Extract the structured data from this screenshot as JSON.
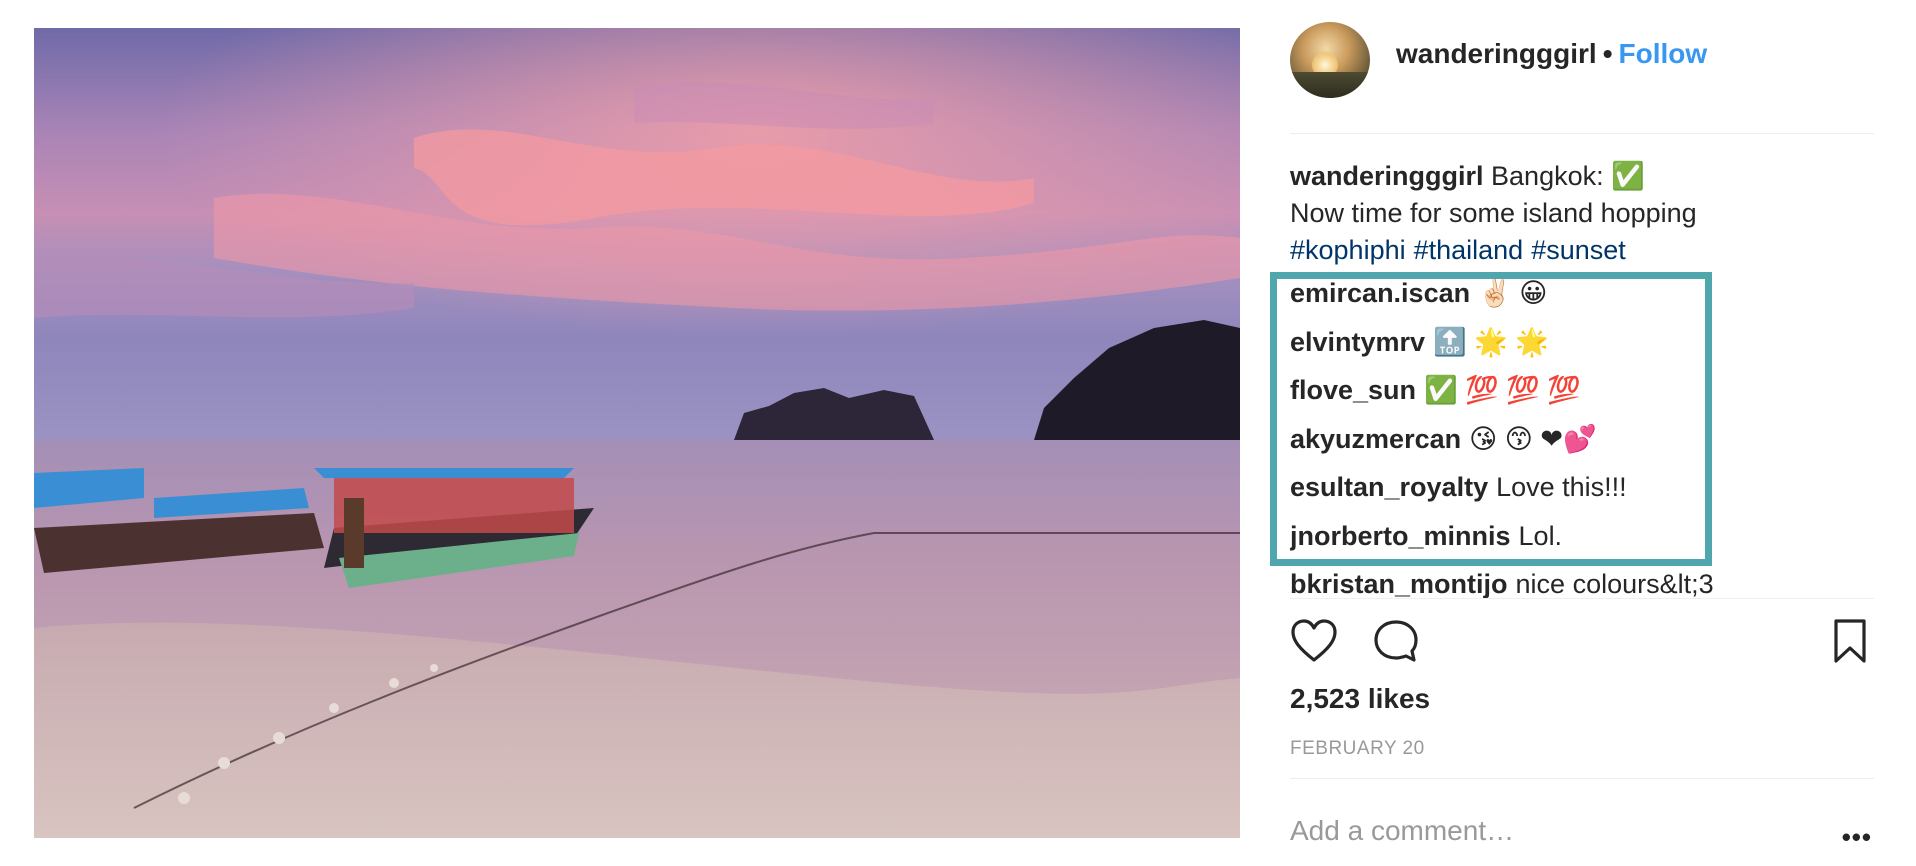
{
  "post": {
    "author": "wanderingggirl",
    "dot": "•",
    "follow_label": "Follow",
    "caption": {
      "username": "wanderingggirl",
      "line1": "Bangkok: ✅",
      "line2": "Now time for some island hopping",
      "hashtags": [
        "#kophiphi",
        "#thailand",
        "#sunset"
      ]
    },
    "comments": [
      {
        "username": "emircan.iscan",
        "text": "✌🏻 😀"
      },
      {
        "username": "elvintymrv",
        "text": "🔝 🌟 🌟"
      },
      {
        "username": "flove_sun",
        "text": "✅ 💯 💯 💯"
      },
      {
        "username": "akyuzmercan",
        "text": "😘 😙 ❤💕"
      },
      {
        "username": "esultan_royalty",
        "text": "Love this!!!"
      },
      {
        "username": "jnorberto_minnis",
        "text": "Lol."
      },
      {
        "username": "bkristan_montijo",
        "text": "nice colours&lt;3"
      }
    ],
    "likes": "2,523 likes",
    "date": "FEBRUARY 20",
    "add_comment_placeholder": "Add a comment…",
    "more_label": "•••"
  },
  "icons": {
    "like": "heart-icon",
    "comment": "comment-icon",
    "save": "bookmark-icon",
    "more": "more-options-icon"
  },
  "colors": {
    "follow": "#3897f0",
    "hashtag": "#003569",
    "highlight_border": "#4fa6ad",
    "muted": "#999999"
  }
}
